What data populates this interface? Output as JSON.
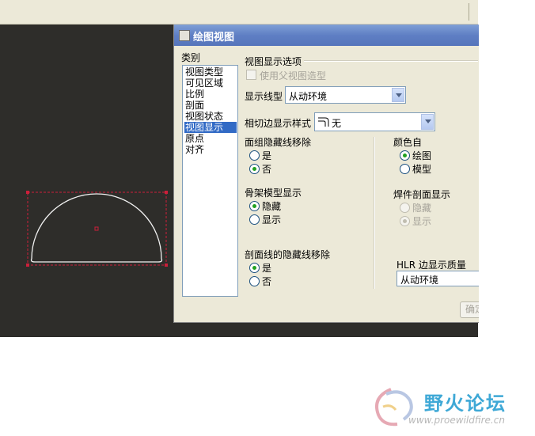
{
  "dialog": {
    "title": "绘图视图",
    "category_label": "类别",
    "categories": [
      "视图类型",
      "可见区域",
      "比例",
      "剖面",
      "视图状态",
      "视图显示",
      "原点",
      "对齐"
    ],
    "selected_category": "视图显示",
    "section_title": "视图显示选项",
    "use_parent_label": "使用父视图造型",
    "display_style_label": "显示线型",
    "display_style_value": "从动环境",
    "tangent_label": "相切边显示样式",
    "tangent_value": "无",
    "face_group": {
      "title": "面组隐藏线移除",
      "options": [
        "是",
        "否"
      ],
      "selected": "否"
    },
    "color_from": {
      "title": "颜色自",
      "options": [
        "绘图",
        "模型"
      ],
      "selected": "绘图"
    },
    "skeleton": {
      "title": "骨架模型显示",
      "options": [
        "隐藏",
        "显示"
      ],
      "selected": "隐藏"
    },
    "weld": {
      "title": "焊件剖面显示",
      "options": [
        "隐藏",
        "显示"
      ],
      "selected": "显示"
    },
    "section_lines": {
      "title": "剖面线的隐藏线移除",
      "options": [
        "是",
        "否"
      ],
      "selected": "是"
    },
    "hlr": {
      "title": "HLR 边显示质量",
      "value": "从动环境"
    },
    "ok_label": "确定"
  },
  "watermark": {
    "name": "野火论坛",
    "url": "www.proewildfire.cn"
  },
  "colors": {
    "canvas": "#2e2d2a",
    "dialog_bg": "#ece9d8",
    "titlebar": "#5f7fc4",
    "selection": "#316ac5",
    "selection_box": "#cc1f3a",
    "watermark": "#3ea8d6"
  }
}
